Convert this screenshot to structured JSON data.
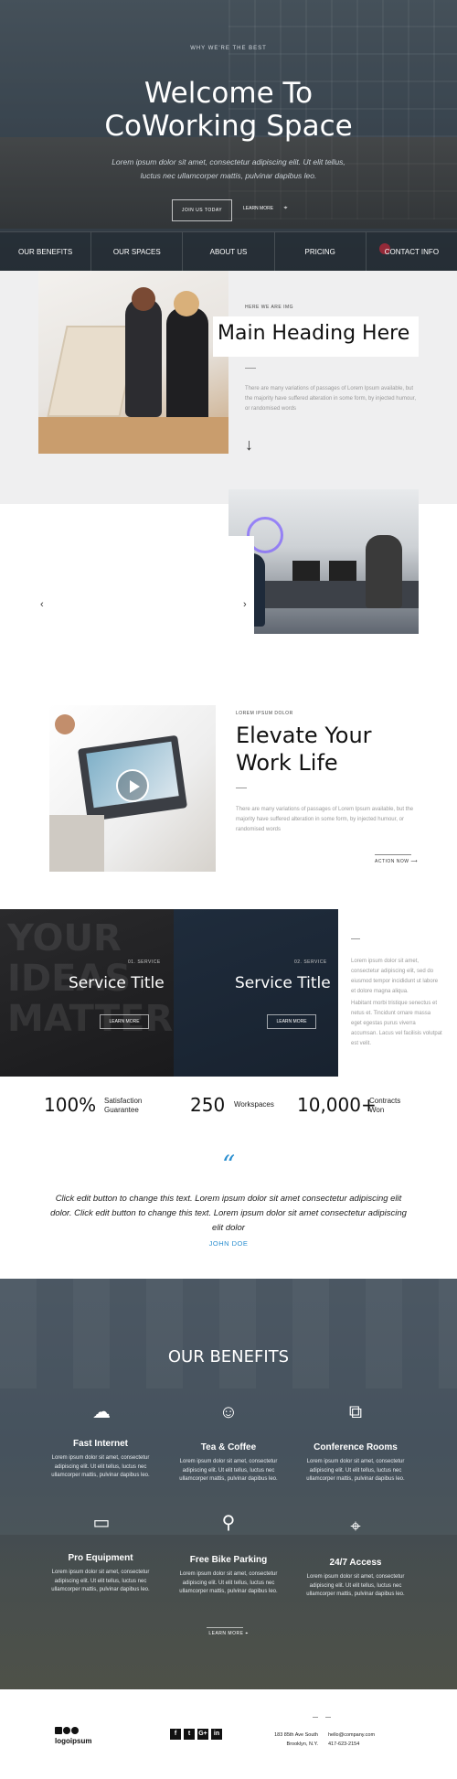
{
  "hero": {
    "kicker": "WHY WE'RE THE BEST",
    "title_line1": "Welcome To",
    "title_line2": "CoWorking Space",
    "subtitle": "Lorem ipsum dolor sit amet, consectetur adipiscing elit. Ut elit tellus, luctus nec ullamcorper mattis, pulvinar dapibus leo.",
    "join_button": "JOIN US TODAY",
    "learn_more": "LEARN MORE"
  },
  "nav": {
    "items": [
      "OUR BENEFITS",
      "OUR SPACES",
      "ABOUT US",
      "PRICING",
      "CONTACT INFO"
    ]
  },
  "intro": {
    "kicker": "HERE WE ARE IMG",
    "heading": "Main Heading Here",
    "paragraph": "There are many variations of passages of Lorem Ipsum available, but the majority have suffered alteration in some form, by injected humour, or randomised words",
    "down_arrow": "↓"
  },
  "slider": {
    "prev": "‹",
    "next": "›"
  },
  "elevate": {
    "kicker": "LOREM IPSUM DOLOR",
    "title_line1": "Elevate Your",
    "title_line2": "Work Life",
    "paragraph": "There are many variations of passages of Lorem Ipsum available, but the majority have suffered alteration in some form, by injected humour, or randomised words",
    "action": "ACTION NOW"
  },
  "services": {
    "background_text": [
      "YOUR",
      "IDEAS",
      "MATTER"
    ],
    "cards": [
      {
        "kicker": "01. SERVICE",
        "title": "Service Title",
        "button": "LEARN MORE"
      },
      {
        "kicker": "02. SERVICE",
        "title": "Service Title",
        "button": "LEARN MORE"
      }
    ],
    "paragraph1": "Lorem ipsum dolor sit amet, consectetur adipiscing elit, sed do eiusmod tempor incididunt ut labore et dolore magna aliqua.",
    "paragraph2": "Habitant morbi tristique senectus et netus et. Tincidunt ornare massa eget egestas purus viverra accumsan. Lacus vel facilisis volutpat est velit."
  },
  "stats": [
    {
      "number": "100%",
      "label_line1": "Satisfaction",
      "label_line2": "Guarantee"
    },
    {
      "number": "250",
      "label_line1": "Workspaces",
      "label_line2": ""
    },
    {
      "number": "10,000+",
      "label_line1": "Contracts",
      "label_line2": "Won"
    }
  ],
  "testimonial": {
    "quote_mark": "“",
    "text": "Click edit button to change this text. Lorem ipsum dolor sit amet consectetur adipiscing elit dolor. Click edit button to change this text. Lorem ipsum dolor sit amet consectetur adipiscing elit dolor",
    "author": "JOHN DOE"
  },
  "benefits": {
    "title": "OUR BENEFITS",
    "items": [
      {
        "icon": "cloud-icon",
        "glyph": "☁",
        "title": "Fast Internet",
        "text": "Lorem ipsum dolor sit amet, consectetur adipiscing elit. Ut elit tellus, luctus nec ullamcorper mattis, pulvinar dapibus leo."
      },
      {
        "icon": "smile-icon",
        "glyph": "☺",
        "title": "Tea & Coffee",
        "text": "Lorem ipsum dolor sit amet, consectetur adipiscing elit. Ut elit tellus, luctus nec ullamcorper mattis, pulvinar dapibus leo."
      },
      {
        "icon": "presentation-icon",
        "glyph": "⧉",
        "title": "Conference Rooms",
        "text": "Lorem ipsum dolor sit amet, consectetur adipiscing elit. Ut elit tellus, luctus nec ullamcorper mattis, pulvinar dapibus leo."
      },
      {
        "icon": "monitor-icon",
        "glyph": "▭",
        "title": "Pro Equipment",
        "text": "Lorem ipsum dolor sit amet, consectetur adipiscing elit. Ut elit tellus, luctus nec ullamcorper mattis, pulvinar dapibus leo."
      },
      {
        "icon": "bike-icon",
        "glyph": "⚲",
        "title": "Free Bike Parking",
        "text": "Lorem ipsum dolor sit amet, consectetur adipiscing elit. Ut elit tellus, luctus nec ullamcorper mattis, pulvinar dapibus leo."
      },
      {
        "icon": "map-pin-icon",
        "glyph": "⌖",
        "title": "24/7 Access",
        "text": "Lorem ipsum dolor sit amet, consectetur adipiscing elit. Ut elit tellus, luctus nec ullamcorper mattis, pulvinar dapibus leo."
      }
    ],
    "learn_more": "LEARN MORE"
  },
  "footer": {
    "logo": "logoipsum",
    "socials": [
      {
        "icon": "facebook-icon",
        "glyph": "f"
      },
      {
        "icon": "twitter-icon",
        "glyph": "t"
      },
      {
        "icon": "google-plus-icon",
        "glyph": "G+"
      },
      {
        "icon": "linkedin-icon",
        "glyph": "in"
      }
    ],
    "address_line1": "183 85th Ave South",
    "address_line2": "Brooklyn, N.Y.",
    "email": "hello@company.com",
    "phone": "417-623-2154"
  },
  "colors": {
    "accent": "#2b8fd0",
    "dark": "#111111",
    "contact_dot": "#b9283a"
  }
}
